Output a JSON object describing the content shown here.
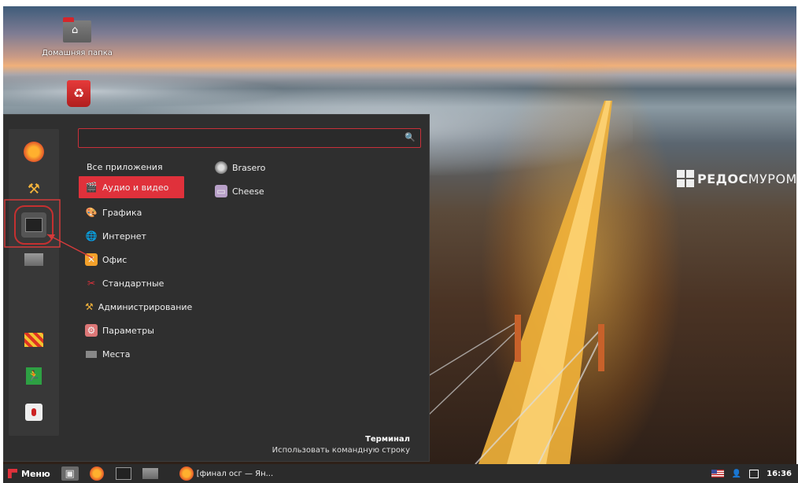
{
  "desktop": {
    "home_folder_label": "Домашняя папка",
    "watermark": {
      "part1": "РЕД",
      "part2": "ОС",
      "part3": "МУРОМ"
    }
  },
  "menu": {
    "search": {
      "value": "",
      "placeholder": ""
    },
    "categories": [
      {
        "label": "Все приложения",
        "icon": "none",
        "selected": false
      },
      {
        "label": "Аудио и видео",
        "icon": "clapperboard-icon",
        "selected": true
      },
      {
        "label": "Графика",
        "icon": "graphics-icon",
        "selected": false
      },
      {
        "label": "Интернет",
        "icon": "globe-icon",
        "selected": false
      },
      {
        "label": "Офис",
        "icon": "office-icon",
        "selected": false
      },
      {
        "label": "Стандартные",
        "icon": "scissors-icon",
        "selected": false
      },
      {
        "label": "Администрирование",
        "icon": "tools-icon",
        "selected": false
      },
      {
        "label": "Параметры",
        "icon": "settings-icon",
        "selected": false
      },
      {
        "label": "Места",
        "icon": "folder-icon",
        "selected": false
      }
    ],
    "apps": [
      {
        "label": "Brasero",
        "icon": "disc-icon"
      },
      {
        "label": "Cheese",
        "icon": "webcam-icon"
      }
    ],
    "description": {
      "title": "Терминал",
      "text": "Использовать командную строку"
    },
    "favorites": [
      "firefox-icon",
      "tools-icon",
      "terminal-icon",
      "folder-icon",
      "warning-icon",
      "logout-icon",
      "shutdown-icon"
    ]
  },
  "taskbar": {
    "menu_label": "Меню",
    "window_title": "[финал осг — Ян...",
    "clock": "16:36"
  },
  "colors": {
    "accent": "#e0313b",
    "menu_bg": "#2f2f2f",
    "taskbar_bg": "#2b2b2b"
  }
}
